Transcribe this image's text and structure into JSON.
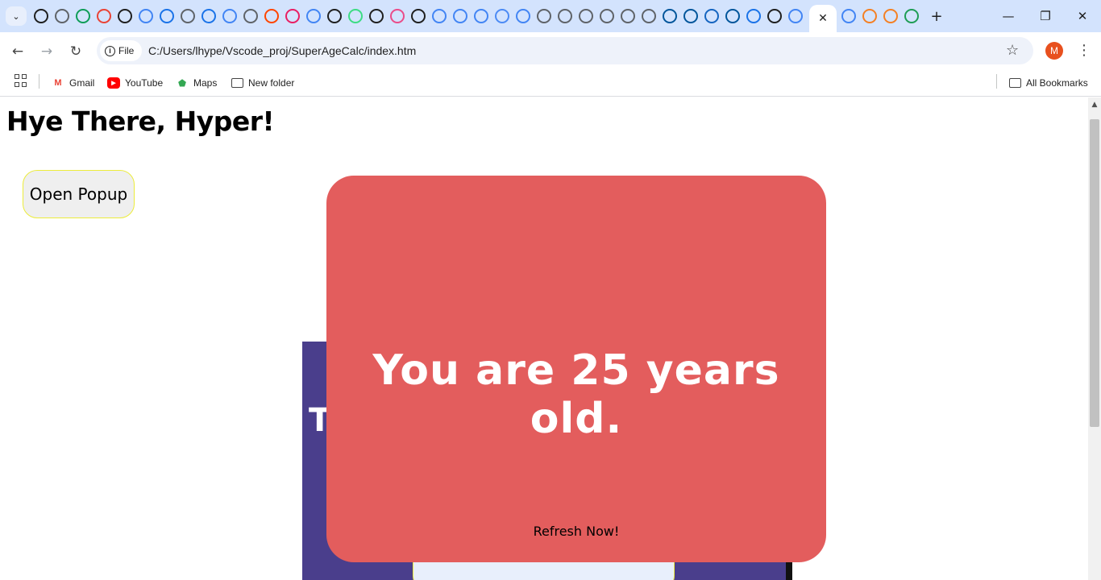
{
  "browser": {
    "tab_search_icon": "chevron-down-icon",
    "active_tab_close": "✕",
    "new_tab": "+",
    "window_controls": {
      "minimize": "—",
      "restore": "❐",
      "close": "✕"
    },
    "file_chip_label": "File",
    "url": "C:/Users/lhype/Vscode_proj/SuperAgeCalc/index.htm",
    "profile_initial": "M",
    "bookmarks": [
      {
        "label": "Gmail",
        "icon": "gmail-icon",
        "glyph": "M",
        "color": "#ea4335"
      },
      {
        "label": "YouTube",
        "icon": "youtube-icon",
        "glyph": "▶",
        "color": "#ff0000"
      },
      {
        "label": "Maps",
        "icon": "maps-icon",
        "glyph": "⬟",
        "color": "#34a853"
      },
      {
        "label": "New folder",
        "icon": "folder-icon"
      }
    ],
    "all_bookmarks": "All Bookmarks"
  },
  "page": {
    "greeting": "Hye There, Hyper!",
    "open_popup_label": "Open Popup",
    "calc_title_partial": "T",
    "popup": {
      "message": "You are 25 years old.",
      "refresh_label": "Refresh Now!"
    }
  },
  "colors": {
    "popup_bg": "#e35d5d",
    "card_bg": "#4a3e8c",
    "tabstrip_bg": "#d3e3fd"
  }
}
